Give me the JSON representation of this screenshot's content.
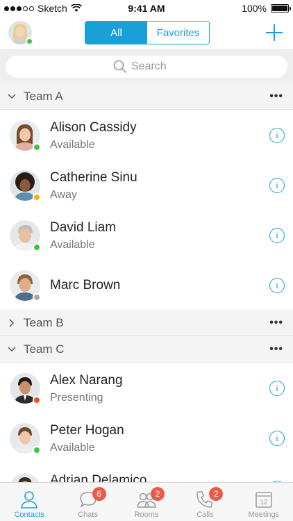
{
  "status_bar": {
    "carrier": "Sketch",
    "time": "9:41 AM",
    "battery": "100%"
  },
  "top_bar": {
    "segments": [
      {
        "label": "All",
        "selected": true
      },
      {
        "label": "Favorites",
        "selected": false
      }
    ]
  },
  "search": {
    "placeholder": "Search"
  },
  "groups": [
    {
      "name": "Team A",
      "expanded": true
    },
    {
      "name": "Team B",
      "expanded": false
    },
    {
      "name": "Team C",
      "expanded": true
    }
  ],
  "contacts": [
    {
      "name": "Alison Cassidy",
      "status": "Available",
      "presence": "green"
    },
    {
      "name": "Catherine Sinu",
      "status": "Away",
      "presence": "yellow"
    },
    {
      "name": "David Liam",
      "status": "Available",
      "presence": "green"
    },
    {
      "name": "Marc Brown",
      "status": "",
      "presence": "gray"
    },
    {
      "name": "Alex Narang",
      "status": "Presenting",
      "presence": "red"
    },
    {
      "name": "Peter Hogan",
      "status": "Available",
      "presence": "green"
    },
    {
      "name": "Adrian Delamico",
      "status": "",
      "presence": ""
    }
  ],
  "colors": {
    "accent": "#1aa0d8",
    "presence_green": "#3ec43e",
    "presence_yellow": "#f6b300",
    "presence_red": "#f04f1e",
    "presence_gray": "#aaaaaa",
    "badge": "#ea5b4a"
  },
  "tabs": [
    {
      "label": "Contacts",
      "icon": "person-icon",
      "badge": "",
      "active": true
    },
    {
      "label": "Chats",
      "icon": "chat-bubble-icon",
      "badge": "6",
      "active": false
    },
    {
      "label": "Rooms",
      "icon": "people-icon",
      "badge": "2",
      "active": false
    },
    {
      "label": "Calls",
      "icon": "phone-icon",
      "badge": "2",
      "active": false
    },
    {
      "label": "Meetings",
      "icon": "calendar-icon",
      "badge": "",
      "calendar_day": "12",
      "active": false
    }
  ]
}
